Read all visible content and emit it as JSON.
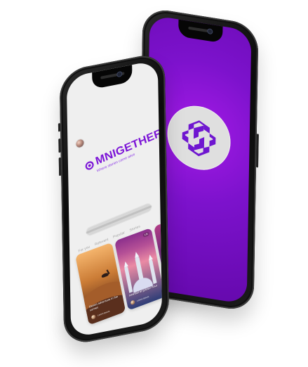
{
  "front_phone": {
    "brand_title": "MNIGETHER",
    "brand_subtitle": "Where stories come alive",
    "tabs": [
      "For you",
      "Relevant",
      "Popular",
      "Stories"
    ],
    "cards": [
      {
        "title": "Desert adventure in the sunset",
        "author": "Lorem Ipsum"
      },
      {
        "title": "Istanbul at golden hour",
        "author": "Lorem Ipsum",
        "counter": "1/5"
      },
      {
        "title": "",
        "author": ""
      }
    ]
  },
  "back_phone": {
    "logo_name": "omnigether-mark-icon"
  },
  "colors": {
    "brand_purple": "#7c15d7",
    "back_gradient_start": "#a31ae6",
    "back_gradient_end": "#6509ad",
    "front_background": "#efefef",
    "frame_black": "#0b0b0b"
  }
}
